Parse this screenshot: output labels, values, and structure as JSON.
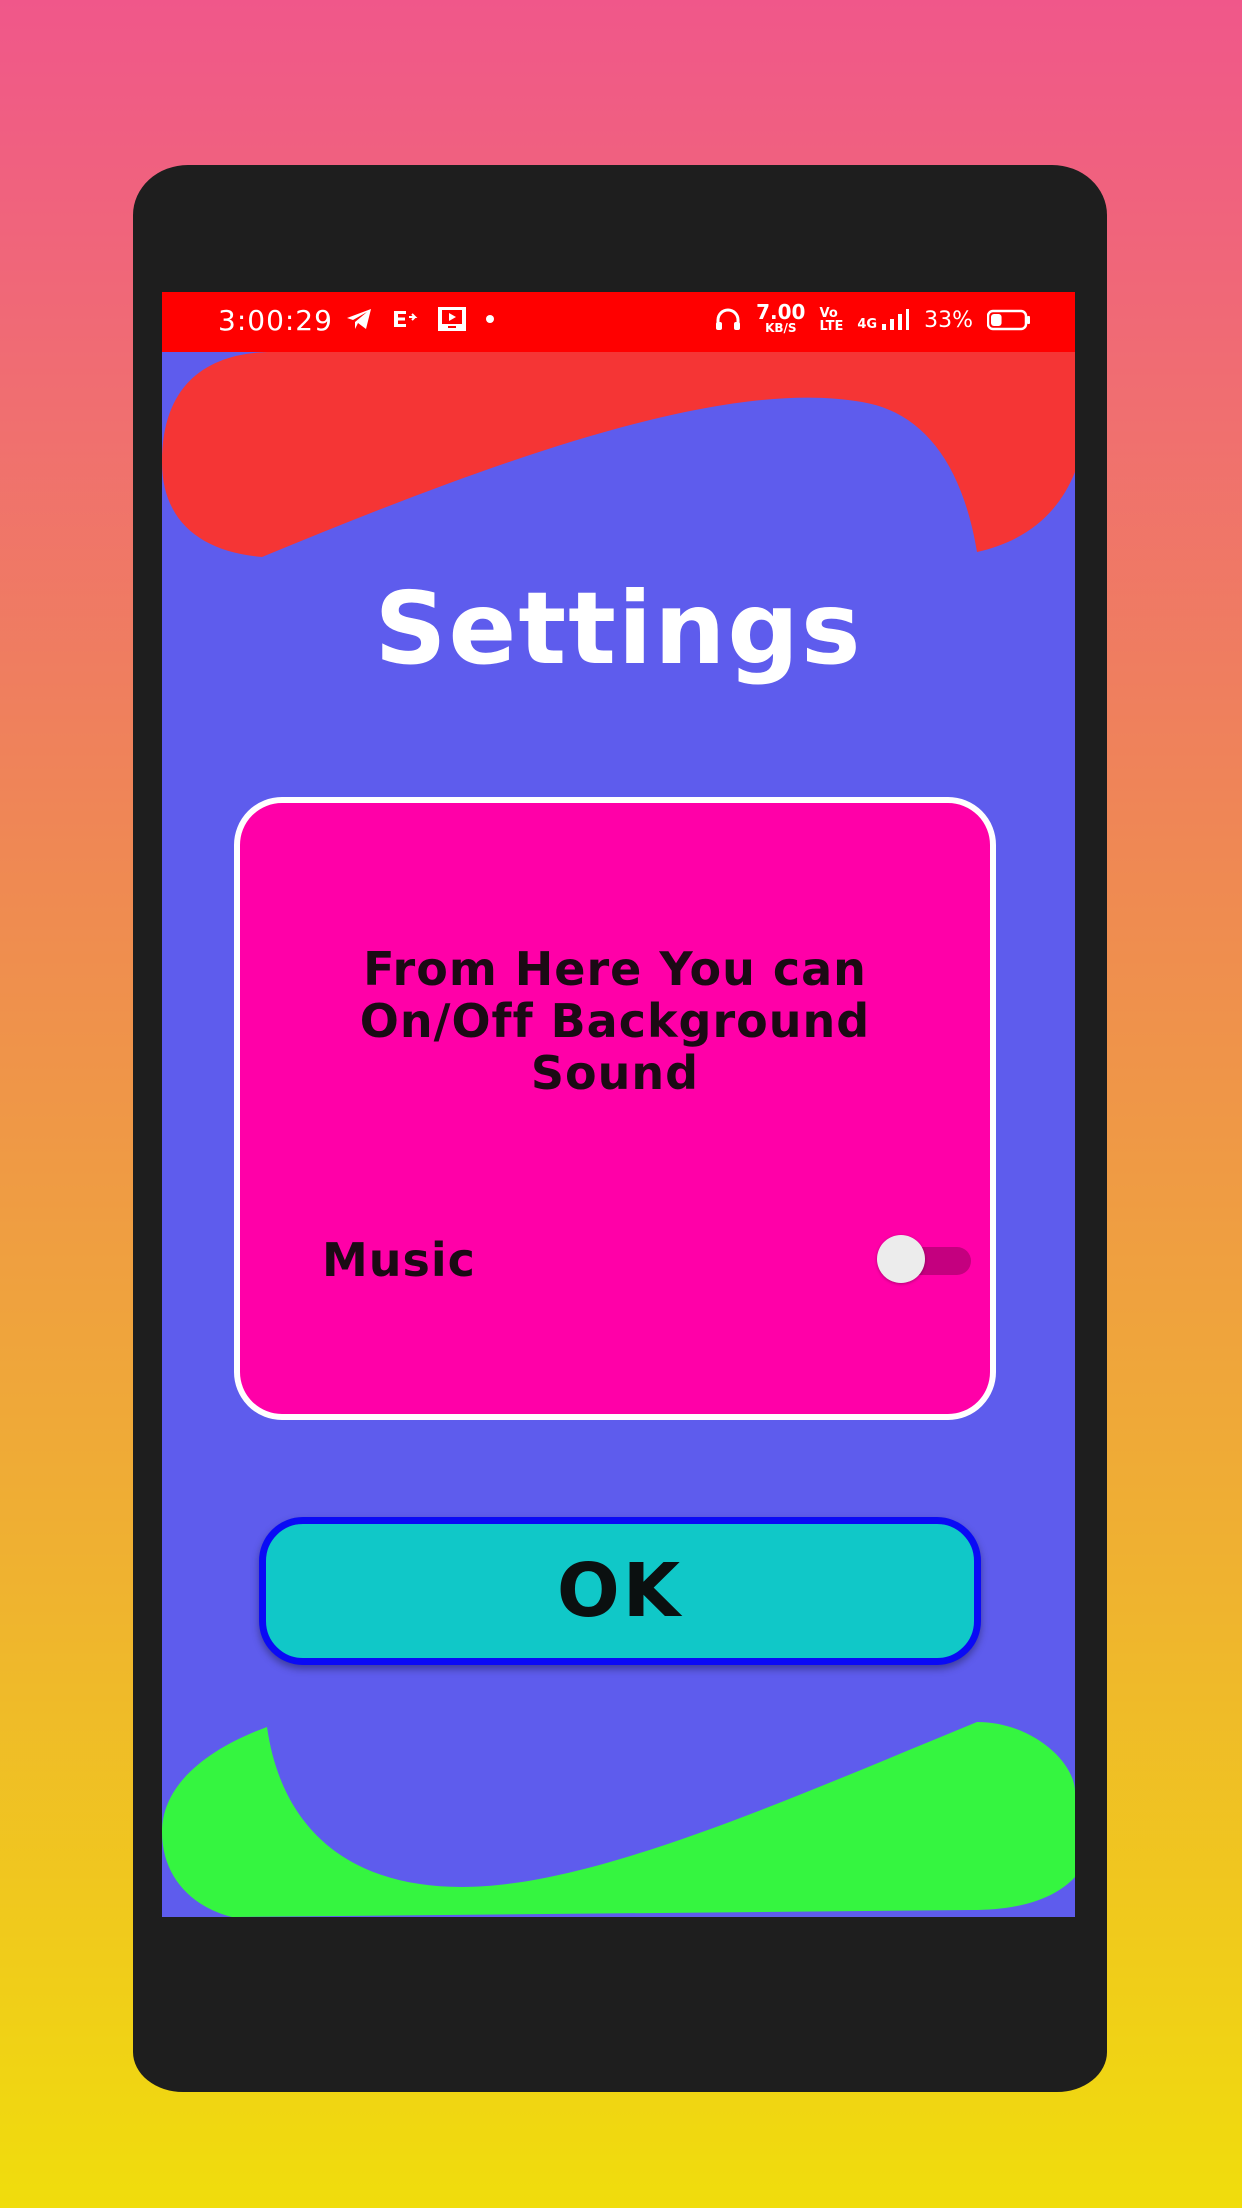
{
  "status_bar": {
    "time": "3:00:29",
    "speed_value": "7.00",
    "speed_unit": "KB/S",
    "volte_top": "Vo",
    "volte_bottom": "LTE",
    "network": "4G",
    "battery_percent": "33%",
    "battery_level": 0.33,
    "color": "#ff0000"
  },
  "page": {
    "title": "Settings",
    "background_color": "#5e5ced"
  },
  "card": {
    "description": "From Here You can On/Off Background Sound",
    "music_label": "Music",
    "music_toggle_on": false,
    "color": "#ff00a8"
  },
  "ok_button": {
    "label": "OK",
    "color": "#10c8c8",
    "border_color": "#0a0af5"
  },
  "decor": {
    "top_blob_color": "#f53535",
    "bottom_blob_color": "#35f540"
  }
}
